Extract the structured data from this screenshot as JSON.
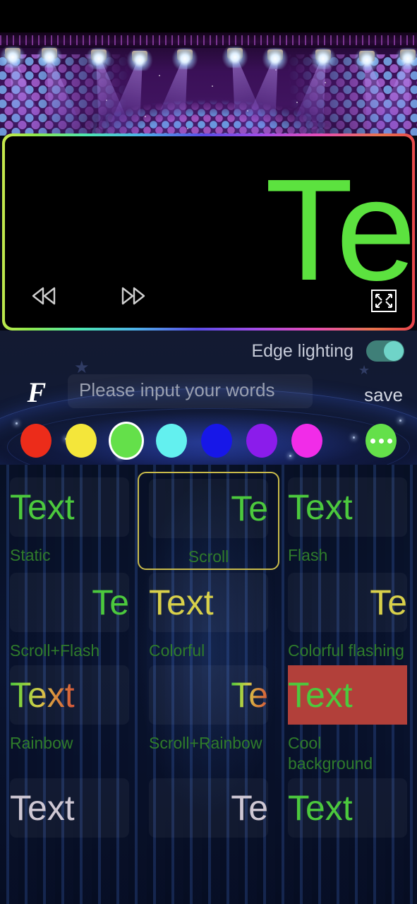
{
  "banner": {
    "name": "stage-lights-banner"
  },
  "preview": {
    "text": "Te",
    "text_color": "#5ce23f",
    "background": "#000000",
    "border": "rainbow-gradient",
    "rewind_label": "rewind",
    "forward_label": "fast-forward",
    "fullscreen_label": "fullscreen"
  },
  "controls": {
    "edge_lighting_label": "Edge lighting",
    "edge_lighting_on": true,
    "font_icon_glyph": "F",
    "input_placeholder": "Please input your words",
    "input_value": "",
    "save_label": "save"
  },
  "colors": {
    "selected_index": 2,
    "swatches": [
      {
        "name": "red",
        "hex": "#ec2c1a"
      },
      {
        "name": "yellow",
        "hex": "#f4e63a"
      },
      {
        "name": "green",
        "hex": "#64e04a"
      },
      {
        "name": "cyan",
        "hex": "#63f0ef"
      },
      {
        "name": "blue",
        "hex": "#1717e8"
      },
      {
        "name": "purple",
        "hex": "#8b1ceb"
      },
      {
        "name": "magenta",
        "hex": "#f12ce8"
      }
    ],
    "more_button": {
      "name": "more-colors",
      "hex": "#64e04a",
      "glyph": "•••"
    }
  },
  "effects": [
    {
      "label": "Static",
      "text": "Text",
      "style": "green",
      "align": "lead",
      "selected": false
    },
    {
      "label": "Scroll",
      "text": "Te",
      "style": "green",
      "align": "trail",
      "selected": true
    },
    {
      "label": "Flash",
      "text": "Text",
      "style": "green",
      "align": "lead",
      "selected": false
    },
    {
      "label": "Scroll+Flash",
      "text": "Te",
      "style": "green",
      "align": "trail",
      "selected": false
    },
    {
      "label": "Colorful",
      "text": "Text",
      "style": "yellow",
      "align": "lead",
      "selected": false
    },
    {
      "label": "Colorful flashing",
      "text": "Te",
      "style": "yellow",
      "align": "trail",
      "selected": false
    },
    {
      "label": "Rainbow",
      "text": "Text",
      "style": "rainbow",
      "align": "lead",
      "selected": false
    },
    {
      "label": "Scroll+Rainbow",
      "text": "Te",
      "style": "rainbow",
      "align": "trail",
      "selected": false
    },
    {
      "label": "Cool background",
      "text": "Text",
      "style": "green",
      "align": "lead",
      "selected": false,
      "chip_bg": "#b2403a"
    },
    {
      "label": "",
      "text": "Text",
      "style": "white",
      "align": "lead",
      "selected": false
    },
    {
      "label": "",
      "text": "Te",
      "style": "white",
      "align": "trail",
      "selected": false
    },
    {
      "label": "",
      "text": "Text",
      "style": "green",
      "align": "lead",
      "selected": false
    }
  ]
}
